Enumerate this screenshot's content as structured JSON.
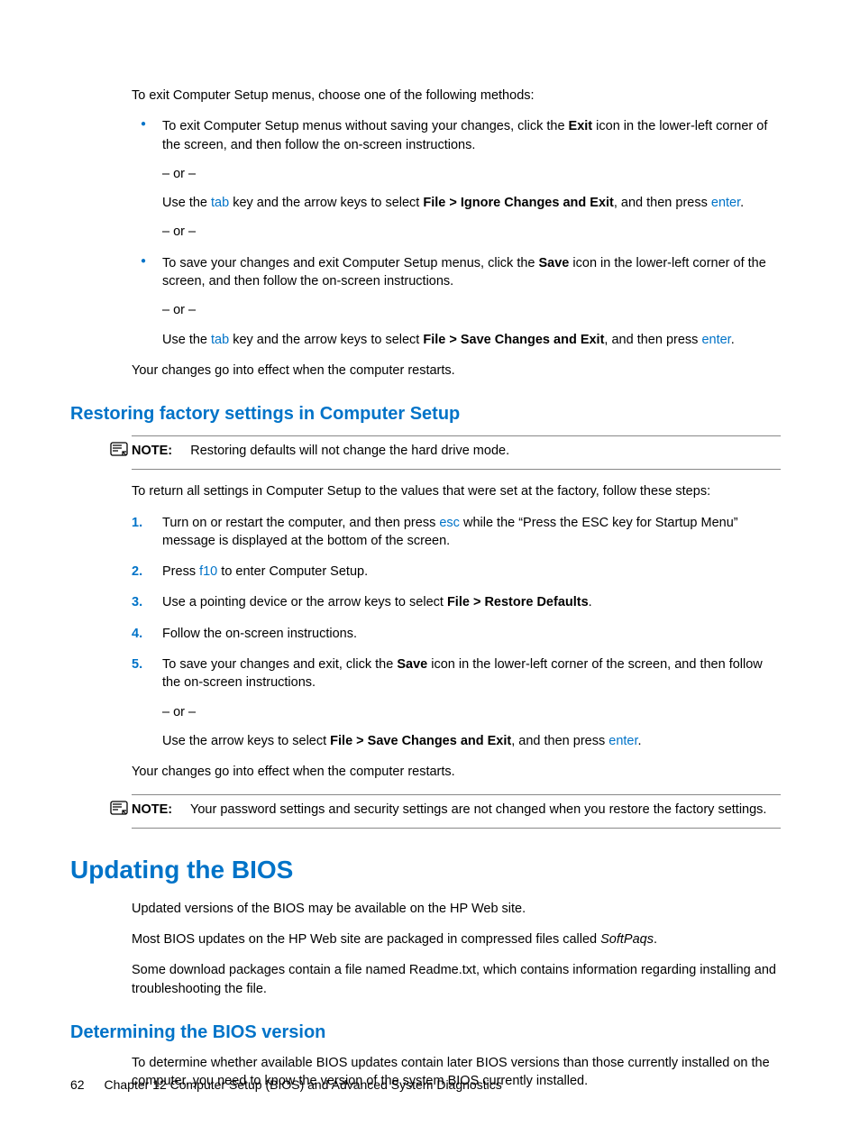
{
  "intro": "To exit Computer Setup menus, choose one of the following methods:",
  "bullet1": {
    "a1": "To exit Computer Setup menus without saving your changes, click the ",
    "a_bold": "Exit",
    "a2": " icon in the lower-left corner of the screen, and then follow the on-screen instructions.",
    "or1": "– or –",
    "b1": "Use the ",
    "b_link1": "tab",
    "b2": " key and the arrow keys to select ",
    "b_bold": "File > Ignore Changes and Exit",
    "b3": ", and then press ",
    "b_link2": "enter",
    "b4": ".",
    "or2": "– or –"
  },
  "bullet2": {
    "a1": "To save your changes and exit Computer Setup menus, click the ",
    "a_bold": "Save",
    "a2": " icon in the lower-left corner of the screen, and then follow the on-screen instructions.",
    "or1": "– or –",
    "b1": "Use the ",
    "b_link1": "tab",
    "b2": " key and the arrow keys to select ",
    "b_bold": "File > Save Changes and Exit",
    "b3": ", and then press ",
    "b_link2": "enter",
    "b4": "."
  },
  "after_bullets": "Your changes go into effect when the computer restarts.",
  "h2_restore": "Restoring factory settings in Computer Setup",
  "note1": {
    "label": "NOTE:",
    "text": "Restoring defaults will not change the hard drive mode."
  },
  "restore_intro": "To return all settings in Computer Setup to the values that were set at the factory, follow these steps:",
  "steps": {
    "s1a": "Turn on or restart the computer, and then press ",
    "s1_link": "esc",
    "s1b": " while the “Press the ESC key for Startup Menu” message is displayed at the bottom of the screen.",
    "s2a": "Press ",
    "s2_link": "f10",
    "s2b": " to enter Computer Setup.",
    "s3a": "Use a pointing device or the arrow keys to select ",
    "s3_bold": "File > Restore Defaults",
    "s3b": ".",
    "s4": "Follow the on-screen instructions.",
    "s5a": "To save your changes and exit, click the ",
    "s5_bold": "Save",
    "s5b": " icon in the lower-left corner of the screen, and then follow the on-screen instructions.",
    "s5_or": "– or –",
    "s5c": "Use the arrow keys to select ",
    "s5_bold2": "File > Save Changes and Exit",
    "s5d": ", and then press ",
    "s5_link": "enter",
    "s5e": "."
  },
  "restore_after": "Your changes go into effect when the computer restarts.",
  "note2": {
    "label": "NOTE:",
    "text": "Your password settings and security settings are not changed when you restore the factory settings."
  },
  "h1_update": "Updating the BIOS",
  "update_p1": "Updated versions of the BIOS may be available on the HP Web site.",
  "update_p2a": "Most BIOS updates on the HP Web site are packaged in compressed files called ",
  "update_p2_italic": "SoftPaqs",
  "update_p2b": ".",
  "update_p3": "Some download packages contain a file named Readme.txt, which contains information regarding installing and troubleshooting the file.",
  "h2_determine": "Determining the BIOS version",
  "determine_p": "To determine whether available BIOS updates contain later BIOS versions than those currently installed on the computer, you need to know the version of the system BIOS currently installed.",
  "footer": {
    "page": "62",
    "chapter": "Chapter 12   Computer Setup (BIOS) and Advanced System Diagnostics"
  }
}
